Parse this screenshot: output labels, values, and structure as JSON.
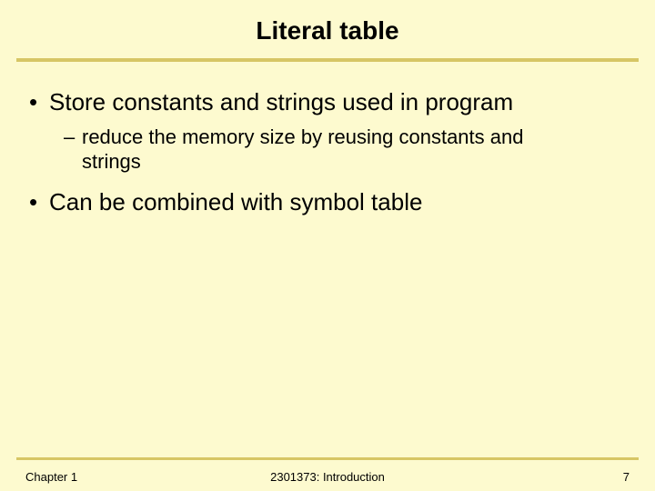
{
  "title": "Literal table",
  "bullets": [
    {
      "level": 1,
      "text": "Store constants and strings used in program"
    },
    {
      "level": 2,
      "text": "reduce the memory size by reusing constants and strings"
    },
    {
      "level": 1,
      "text": "Can be combined with symbol table"
    }
  ],
  "footer": {
    "left": "Chapter 1",
    "center": "2301373: Introduction",
    "right": "7"
  }
}
